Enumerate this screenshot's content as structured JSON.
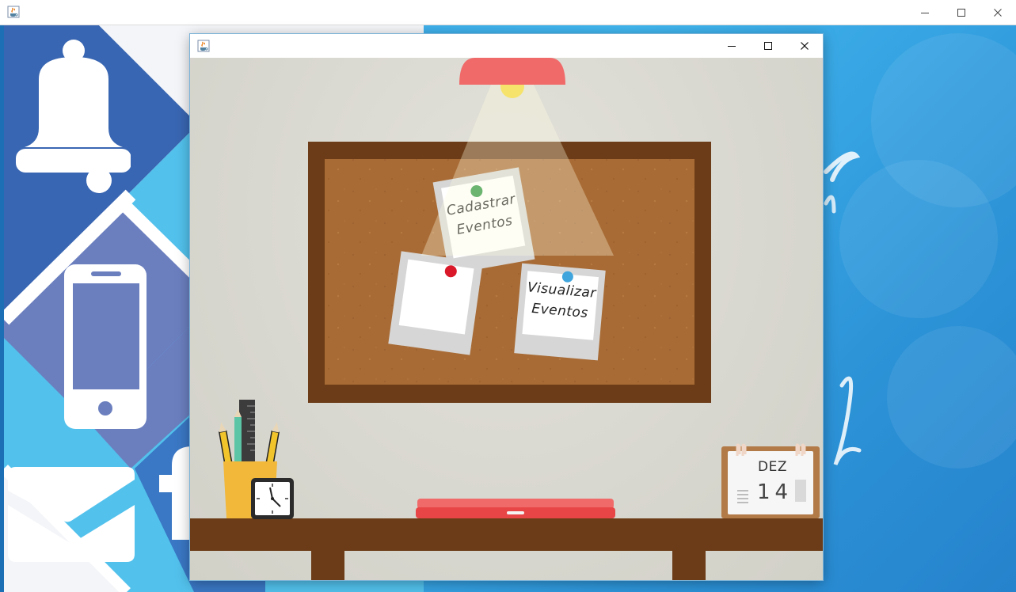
{
  "outer_window": {
    "icon": "java-icon",
    "controls": [
      "minimize-icon",
      "maximize-icon",
      "close-icon"
    ]
  },
  "left_art": {
    "icons": [
      "bell-icon",
      "smartphone-icon",
      "facebook-icon",
      "mail-icon"
    ],
    "colors": {
      "dark_blue": "#3966b2",
      "indigo": "#6b7fbf",
      "light_blue": "#52c1ec"
    }
  },
  "inner_window": {
    "icon": "java-icon",
    "controls": [
      "minimize-icon",
      "maximize-icon",
      "close-icon"
    ]
  },
  "board": {
    "notes": [
      {
        "line1": "Cadastrar",
        "line2": "Eventos",
        "pin_color": "#23933a"
      },
      {
        "line1": "",
        "line2": "",
        "pin_color": "#d9192a"
      },
      {
        "line1": "Visualizar",
        "line2": "Eventos",
        "pin_color": "#3fa5dc"
      }
    ]
  },
  "calendar": {
    "month": "DEZ",
    "day": "14"
  },
  "desk": {
    "items": [
      "pencil-holder",
      "clock-icon",
      "closed-laptop",
      "desk-calendar",
      "ceiling-lamp"
    ]
  },
  "colors": {
    "lamp_shade": "#f06a6a",
    "board_frame": "#6b3c17",
    "cork": "#a86b35",
    "desk": "#6b3c17",
    "pencil_cup": "#f1b83a",
    "laptop": "#ef4b4b"
  }
}
